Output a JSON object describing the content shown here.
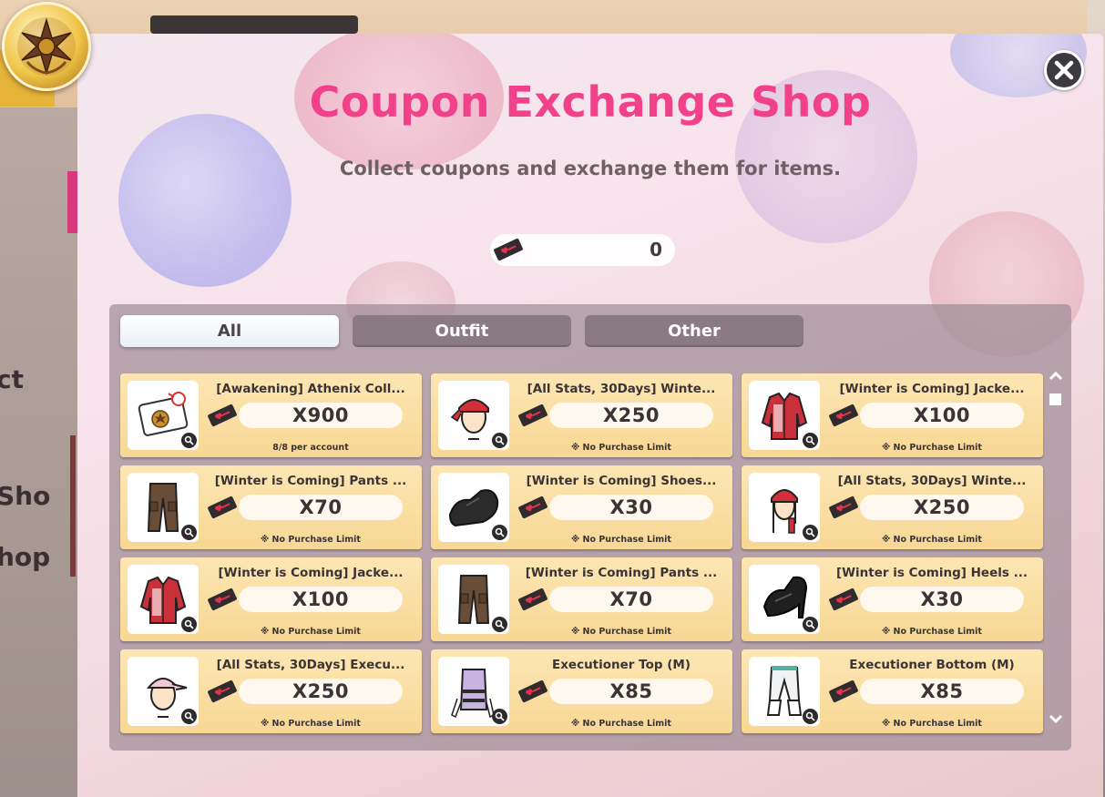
{
  "background": {
    "fragments": [
      "ct",
      "Sho",
      "hop"
    ]
  },
  "header": {
    "title": "Coupon Exchange Shop",
    "subtitle": "Collect coupons and exchange them for items.",
    "balance": "0",
    "close_icon": "close-icon"
  },
  "tabs": [
    {
      "label": "All",
      "active": true
    },
    {
      "label": "Outfit",
      "active": false
    },
    {
      "label": "Other",
      "active": false
    }
  ],
  "items": [
    {
      "name": "[Awakening] Athenix Coll...",
      "price": "X900",
      "limit": "8/8 per account",
      "icon": "card"
    },
    {
      "name": "[All Stats, 30Days] Winte...",
      "price": "X250",
      "limit": "※ No Purchase Limit",
      "icon": "head-bandana"
    },
    {
      "name": "[Winter is Coming] Jacke...",
      "price": "X100",
      "limit": "※ No Purchase Limit",
      "icon": "jacket"
    },
    {
      "name": "[Winter is Coming] Pants ...",
      "price": "X70",
      "limit": "※ No Purchase Limit",
      "icon": "pants"
    },
    {
      "name": "[Winter is Coming] Shoes...",
      "price": "X30",
      "limit": "※ No Purchase Limit",
      "icon": "shoes"
    },
    {
      "name": "[All Stats, 30Days] Winte...",
      "price": "X250",
      "limit": "※ No Purchase Limit",
      "icon": "head-bandana-f"
    },
    {
      "name": "[Winter is Coming] Jacke...",
      "price": "X100",
      "limit": "※ No Purchase Limit",
      "icon": "jacket"
    },
    {
      "name": "[Winter is Coming] Pants ...",
      "price": "X70",
      "limit": "※ No Purchase Limit",
      "icon": "pants"
    },
    {
      "name": "[Winter is Coming] Heels ...",
      "price": "X30",
      "limit": "※ No Purchase Limit",
      "icon": "heels"
    },
    {
      "name": "[All Stats, 30Days] Execu...",
      "price": "X250",
      "limit": "※ No Purchase Limit",
      "icon": "head-cap"
    },
    {
      "name": "Executioner Top (M)",
      "price": "X85",
      "limit": "※ No Purchase Limit",
      "icon": "top"
    },
    {
      "name": "Executioner Bottom (M)",
      "price": "X85",
      "limit": "※ No Purchase Limit",
      "icon": "bottom"
    }
  ],
  "colors": {
    "title": "#f0418a",
    "card": "#fde6b3",
    "ticket": "#2f2b2e",
    "ticket_heart": "#e0344a"
  }
}
